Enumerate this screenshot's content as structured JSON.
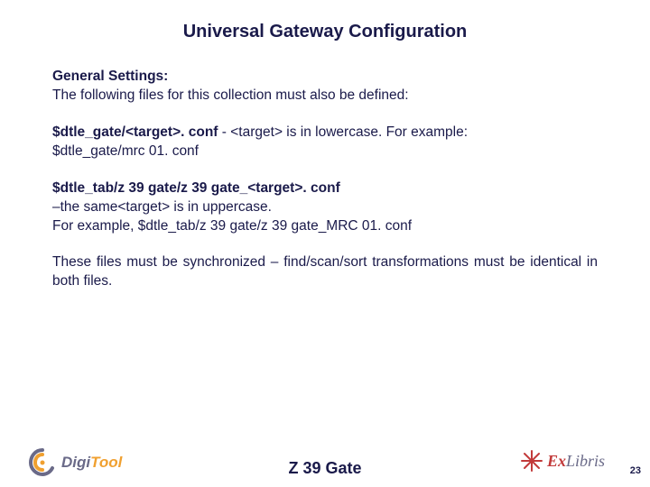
{
  "title": "Universal Gateway Configuration",
  "sections": {
    "s1_heading": "General Settings:",
    "s1_body": "The following files for this collection must also be defined:",
    "s2_bold": "$dtle_gate/<target>. conf",
    "s2_rest": " - <target> is in lowercase. For example:",
    "s2_line3": "$dtle_gate/mrc 01. conf",
    "s3_bold": "$dtle_tab/z 39 gate/z 39 gate_<target>. conf",
    "s3_line2": "–the same<target> is in uppercase.",
    "s3_line3": "For example, $dtle_tab/z 39 gate/z 39 gate_MRC 01. conf",
    "s4": "These files must be synchronized – find/scan/sort transformations must be identical in both files."
  },
  "footer": {
    "title": "Z 39 Gate",
    "page": "23",
    "logo_left": {
      "digi": "Digi",
      "tool": "Tool"
    },
    "logo_right": {
      "ex": "Ex",
      "libris": "Libris"
    }
  }
}
